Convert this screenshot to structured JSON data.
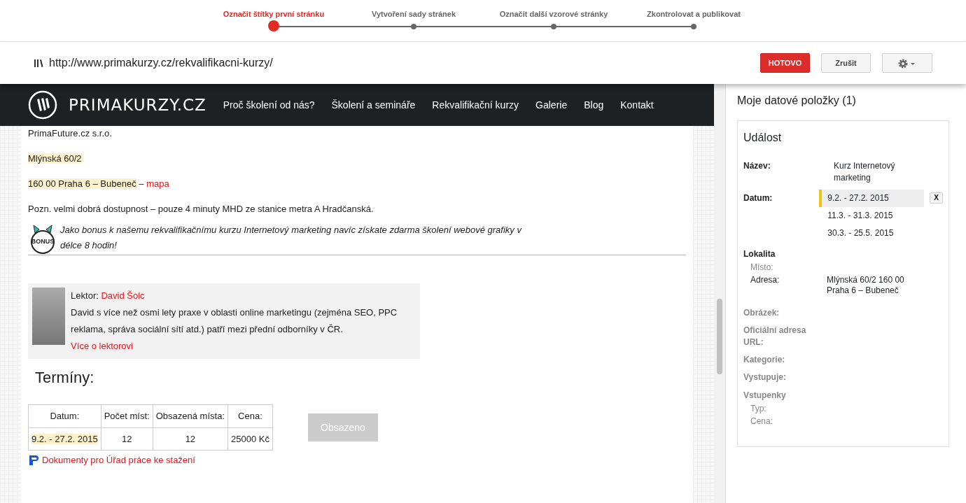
{
  "wizard": {
    "steps": [
      {
        "label": "Označit štítky první stránku",
        "selected": true
      },
      {
        "label": "Vytvoření sady stránek",
        "selected": false
      },
      {
        "label": "Označit další vzorové stránky",
        "selected": false
      },
      {
        "label": "Zkontrolovat a publikovat",
        "selected": false
      }
    ]
  },
  "toolbar": {
    "url": "http://www.primakurzy.cz/rekvalifikacni-kurzy/",
    "done_button": "HOTOVO",
    "cancel_button": "Zrušit"
  },
  "site": {
    "logo_text": "PRIMAKURZY.CZ",
    "nav": [
      "Proč školení od nás?",
      "Školení a semináře",
      "Rekvalifikační kurzy",
      "Galerie",
      "Blog",
      "Kontakt"
    ],
    "address_lines": [
      {
        "text": "PrimaFuture.cz s.r.o.",
        "highlighted": false
      },
      {
        "text": "Mlýnská 60/2",
        "highlighted": true
      },
      {
        "text": "160 00 Praha 6 – Bubeneč",
        "highlighted": true,
        "suffix": " – ",
        "link": "mapa"
      },
      {
        "text": "Pozn. velmi dobrá dostupnost – pouze 4 minuty MHD ze stanice metra A Hradčanská.",
        "highlighted": false
      }
    ],
    "bonus_badge": "BONUS",
    "bonus_text": "Jako bonus k našemu rekvalifikačnímu kurzu Internetový marketing navíc získate zdarma školení webové grafiky v délce 8 hodin!",
    "lecturer": {
      "label": "Lektor: ",
      "name": "David Šolc",
      "bio": "David s více než osmi lety praxe v oblasti online marketingu (zejména SEO, PPC reklama, správa sociální sítí atd.) patří mezi přední odborníky v ČR.",
      "more_link": "Více o lektorovi"
    },
    "terms_heading": "Termíny:",
    "terms_table": {
      "columns": [
        "Datum:",
        "Počet míst:",
        "Obsazená místa:",
        "Cena:"
      ],
      "rows": [
        [
          {
            "text": "9.2. - 27.2. 2015",
            "highlighted": true
          },
          {
            "text": "12",
            "highlighted": false
          },
          {
            "text": "12",
            "highlighted": false
          },
          {
            "text": "25000 Kč",
            "highlighted": false
          }
        ]
      ]
    },
    "booking_button": {
      "label": "Obsazeno",
      "disabled": true
    },
    "documents_link": "Dokumenty pro Úřad práce ke stažení"
  },
  "panel": {
    "title": "Moje datové položky (1)",
    "card_title": "Událost",
    "fields": [
      {
        "kind": "field",
        "label": "Název:",
        "filled": true,
        "values": [
          {
            "text": "Kurz Internetový marketing",
            "selected": false
          }
        ]
      },
      {
        "kind": "field",
        "label": "Datum:",
        "filled": true,
        "values": [
          {
            "text": "9.2. - 27.2. 2015",
            "selected": true
          },
          {
            "text": "11.3. - 31.3. 2015",
            "selected": false
          },
          {
            "text": "30.3. - 25.5. 2015",
            "selected": false
          }
        ],
        "remove_button": "X"
      },
      {
        "kind": "group",
        "label": "Lokalita",
        "filled": true,
        "children": [
          {
            "label": "Místo:",
            "filled": false
          },
          {
            "label": "Adresa:",
            "filled": true,
            "values": [
              {
                "text": "Mlýnská 60/2 160 00 Praha 6 – Bubeneč",
                "selected": false
              }
            ]
          }
        ]
      },
      {
        "kind": "field",
        "label": "Obrázek:",
        "filled": false
      },
      {
        "kind": "field",
        "label": "Oficiální adresa URL:",
        "filled": false
      },
      {
        "kind": "field",
        "label": "Kategorie:",
        "filled": false
      },
      {
        "kind": "field",
        "label": "Vystupuje:",
        "filled": false
      },
      {
        "kind": "group",
        "label": "Vstupenky",
        "filled": false,
        "children": [
          {
            "label": "Typ:",
            "filled": false
          },
          {
            "label": "Cena:",
            "filled": false
          }
        ]
      }
    ]
  }
}
